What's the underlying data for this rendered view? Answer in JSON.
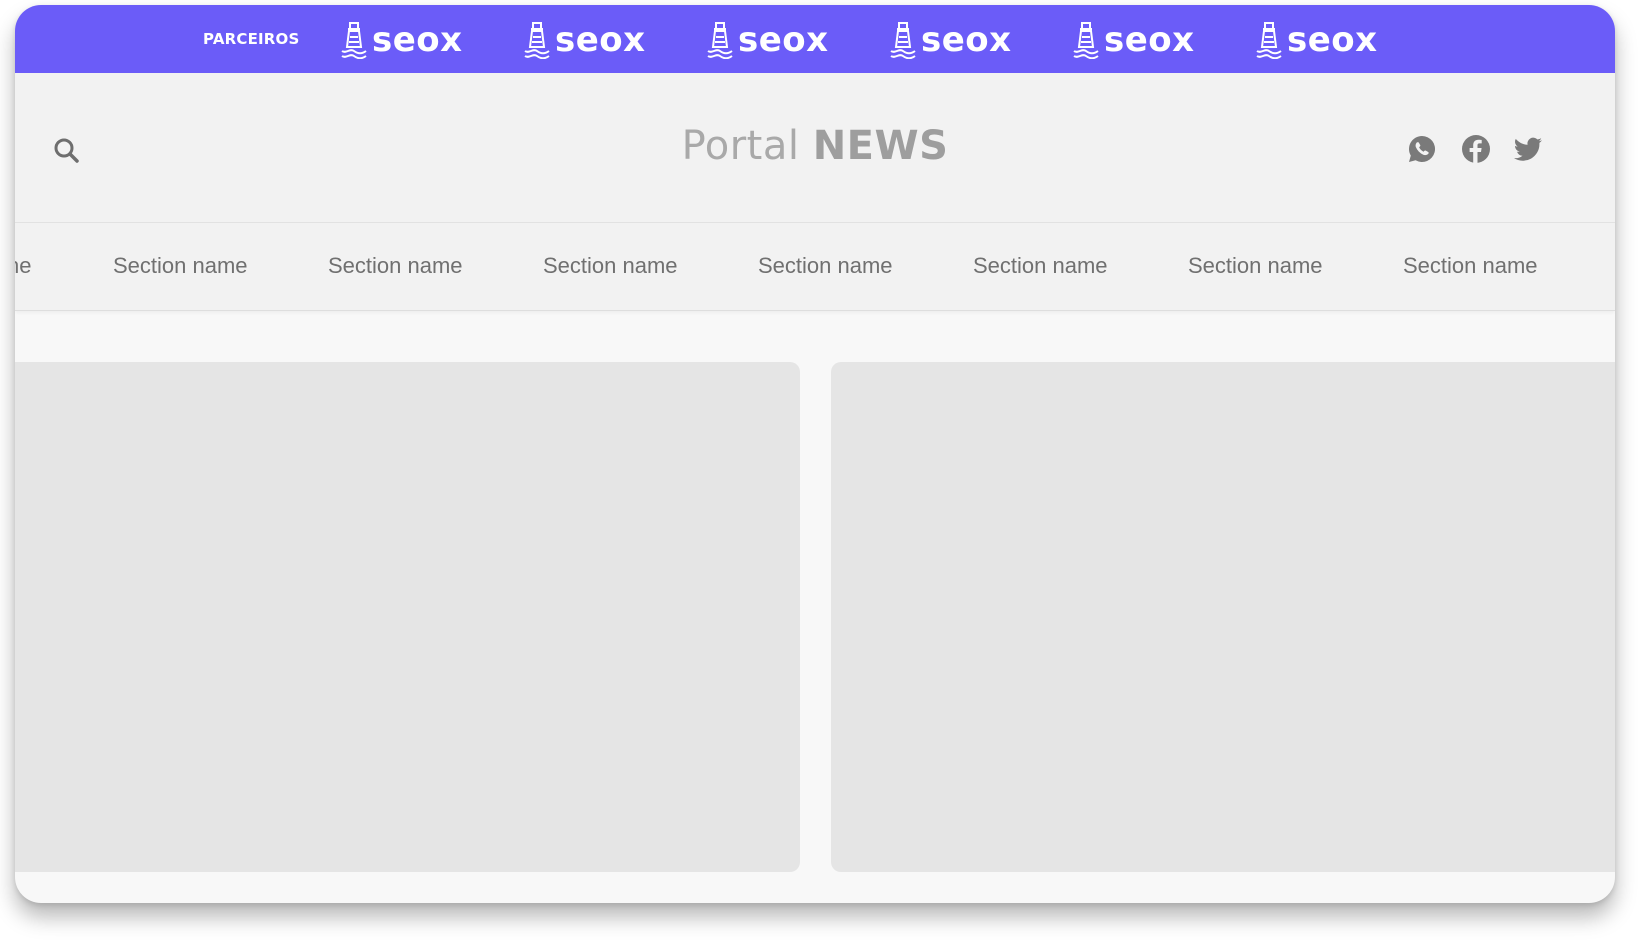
{
  "partners": {
    "label": "PARCEIROS",
    "logos": [
      "seox",
      "seox",
      "seox",
      "seox",
      "seox",
      "seox"
    ],
    "logo_icon": "lighthouse-icon",
    "bar_color": "#6b5cf8"
  },
  "header": {
    "title_light": "Portal",
    "title_bold": "NEWS",
    "search_icon": "search-icon",
    "social_icons": [
      "whatsapp-icon",
      "facebook-icon",
      "twitter-icon"
    ]
  },
  "nav": {
    "partial_item": "ne",
    "items": [
      "Section name",
      "Section name",
      "Section name",
      "Section name",
      "Section name",
      "Section name",
      "Section name"
    ]
  }
}
